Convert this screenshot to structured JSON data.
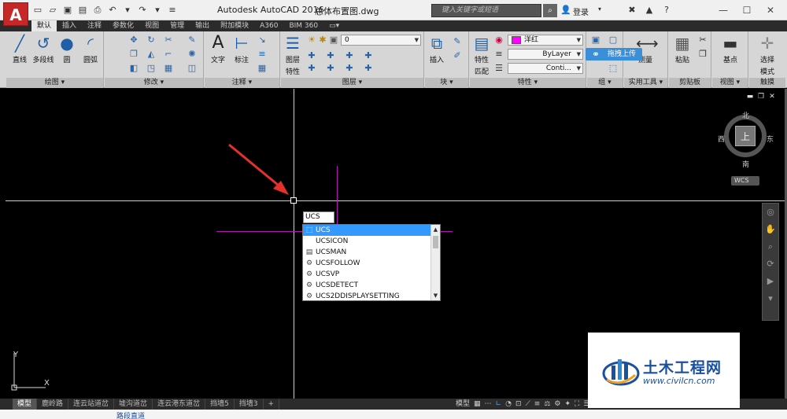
{
  "titlebar": {
    "app_logo": "A",
    "app_name": "Autodesk AutoCAD 2016",
    "file_name": "总体布置图.dwg",
    "search_placeholder": "键入关键字或短语",
    "login_label": "登录",
    "help_label": "?"
  },
  "ribbon_tabs": [
    "默认",
    "插入",
    "注释",
    "参数化",
    "视图",
    "管理",
    "输出",
    "附加模块",
    "A360",
    "BIM 360"
  ],
  "ribbon": {
    "draw": {
      "line": "直线",
      "polyline": "多段线",
      "circle": "圆",
      "arc": "圆弧",
      "title": "绘图 ▾"
    },
    "modify": {
      "title": "修改 ▾"
    },
    "annotation": {
      "text": "文字",
      "dimension": "标注",
      "title": "注释 ▾"
    },
    "layers": {
      "props": "图层",
      "props2": "特性",
      "layer_value": "0",
      "title": "图层 ▾"
    },
    "block": {
      "insert": "插入",
      "title": "块 ▾"
    },
    "properties": {
      "match": "特性",
      "match2": "匹配",
      "color_value": "洋红",
      "linetype_value": "ByLayer",
      "lineweight_value": "Conti...",
      "title": "特性 ▾"
    },
    "groups": {
      "title": "组 ▾"
    },
    "utilities": {
      "measure": "测量",
      "title": "实用工具 ▾"
    },
    "clipboard": {
      "paste": "粘贴",
      "title": "剪贴板"
    },
    "view": {
      "base": "基点",
      "title": "视图 ▾"
    },
    "touch": {
      "select": "选择",
      "select2": "模式",
      "title": "触摸"
    },
    "tooltip": "拖拽上传"
  },
  "command": {
    "input_value": "UCS",
    "suggestions": [
      {
        "label": "UCS",
        "icon": "command-icon",
        "selected": true
      },
      {
        "label": "UCSICON",
        "icon": "none",
        "selected": false
      },
      {
        "label": "UCSMAN",
        "icon": "dialog-icon",
        "selected": false
      },
      {
        "label": "UCSFOLLOW",
        "icon": "sysvar-icon",
        "selected": false
      },
      {
        "label": "UCSVP",
        "icon": "sysvar-icon",
        "selected": false
      },
      {
        "label": "UCSDETECT",
        "icon": "sysvar-icon",
        "selected": false
      },
      {
        "label": "UCS2DDISPLAYSETTING",
        "icon": "sysvar-icon",
        "selected": false
      }
    ]
  },
  "viewcube": {
    "north": "北",
    "south": "南",
    "east": "东",
    "west": "西",
    "face": "上",
    "wcs": "WCS"
  },
  "ucs": {
    "x": "X",
    "y": "Y"
  },
  "layout_tabs": [
    "模型",
    "鹿岭路",
    "连云站道岔",
    "墟沟道岔",
    "连云港东道岔",
    "挡墙5",
    "挡墙3",
    "+"
  ],
  "status_bar": {
    "model": "模型"
  },
  "below_text": "路段直道",
  "watermark": {
    "cn": "土木工程网",
    "url": "www.civilcn.com"
  },
  "colors": {
    "accent": "#3399ff",
    "magenta": "#b418b4",
    "logo_red": "#c62828",
    "brand_blue": "#1b4fa0"
  }
}
